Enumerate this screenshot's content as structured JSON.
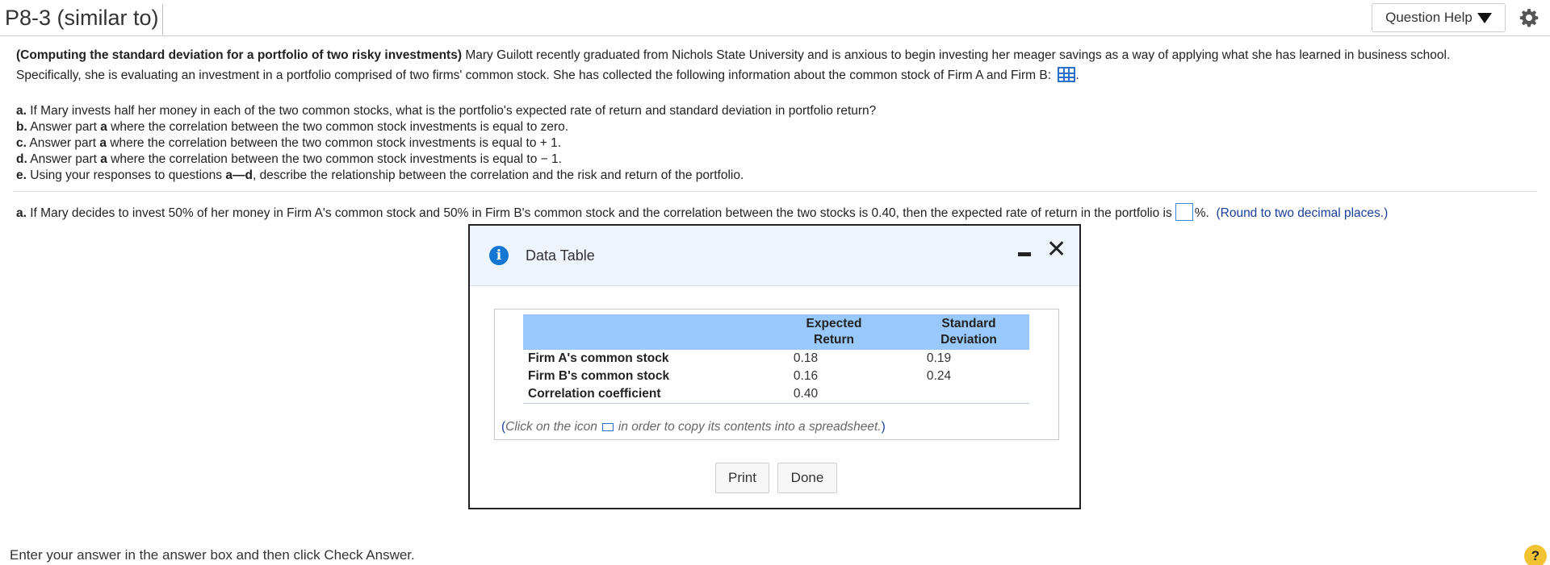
{
  "header": {
    "title": "P8-3 (similar to)",
    "question_help": "Question Help"
  },
  "problem": {
    "bold_intro": "(Computing the standard deviation for a portfolio of two risky investments)",
    "line1_rest": " Mary Guilott recently graduated from Nichols State University and is anxious to begin investing her meager savings as a way of applying what she has learned in business school.",
    "line2": "Specifically, she is evaluating an investment in a portfolio comprised of two firms' common stock. She has collected the following information about the common stock of Firm A and Firm B:",
    "line2_end": ".",
    "parts": [
      {
        "letter": "a.",
        "text": " If Mary invests half her money in each of the two common stocks, what is the portfolio's expected rate of return and standard deviation in portfolio return?",
        "ref": "",
        "tail": ""
      },
      {
        "letter": "b.",
        "text": " Answer part ",
        "ref": "a",
        "tail": " where the correlation between the two common stock investments is equal to zero."
      },
      {
        "letter": "c.",
        "text": " Answer part ",
        "ref": "a",
        "tail": " where the correlation between the two common stock investments is equal to  + 1."
      },
      {
        "letter": "d.",
        "text": " Answer part ",
        "ref": "a",
        "tail": " where the correlation between the two common stock investments is equal to  − 1."
      },
      {
        "letter": "e.",
        "text": " Using your responses to questions ",
        "ref": "a—d",
        "tail": ", describe the relationship between the correlation and the risk and return of the portfolio."
      }
    ]
  },
  "question": {
    "letter": "a.",
    "text": " If Mary decides to invest 50% of her money in Firm A's common stock and 50% in Firm B's common stock and the correlation between the two stocks is 0.40, then the expected rate of return in the portfolio is",
    "suffix": "%.",
    "hint": "(Round to two decimal places.)",
    "answer_value": ""
  },
  "dialog": {
    "title": "Data Table",
    "columns": [
      "Expected Return",
      "Standard Deviation"
    ],
    "col_headers": {
      "c1a": "Expected",
      "c1b": "Return",
      "c2a": "Standard",
      "c2b": "Deviation"
    },
    "rows": [
      {
        "label": "Firm A's common stock",
        "expected_return": "0.18",
        "std_dev": "0.19"
      },
      {
        "label": "Firm B's common stock",
        "expected_return": "0.16",
        "std_dev": "0.24"
      },
      {
        "label": "Correlation coefficient",
        "expected_return": "0.40",
        "std_dev": ""
      }
    ],
    "note_before": "Click on the icon",
    "note_after": "in order to copy its contents into a spreadsheet.",
    "print_label": "Print",
    "done_label": "Done"
  },
  "footer": {
    "text": "Enter your answer in the answer box and then click Check Answer.",
    "help_glyph": "?"
  },
  "icons": [
    "settings-gear-icon",
    "data-table-grid-icon",
    "info-icon",
    "minimize-icon",
    "close-icon",
    "copy-icon",
    "help-icon"
  ]
}
